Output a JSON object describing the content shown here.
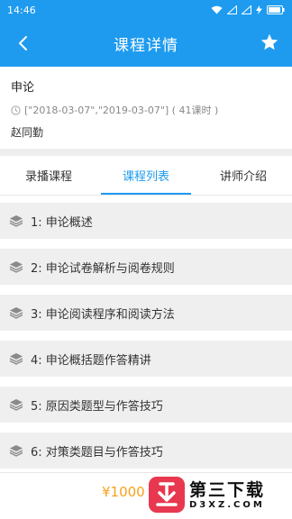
{
  "status_bar": {
    "time": "14:46"
  },
  "header": {
    "title": "课程详情"
  },
  "course": {
    "name": "申论",
    "period": "[\"2018-03-07\",\"2019-03-07\"] ( 41课时 )",
    "teacher": "赵同勤"
  },
  "tabs": [
    {
      "label": "录播课程",
      "active": false
    },
    {
      "label": "课程列表",
      "active": true
    },
    {
      "label": "讲师介绍",
      "active": false
    }
  ],
  "lessons": [
    {
      "label": "1: 申论概述"
    },
    {
      "label": "2: 申论试卷解析与阅卷规则"
    },
    {
      "label": "3:  申论阅读程序和阅读方法"
    },
    {
      "label": "4: 申论概括题作答精讲"
    },
    {
      "label": "5: 原因类题型与作答技巧"
    },
    {
      "label": "6: 对策类题目与作答技巧"
    }
  ],
  "footer": {
    "price": "¥1000"
  },
  "watermark": {
    "title": "第三下载",
    "url": "D3XZ.COM"
  },
  "colors": {
    "primary": "#1e9bef",
    "price": "#f7a11a"
  }
}
